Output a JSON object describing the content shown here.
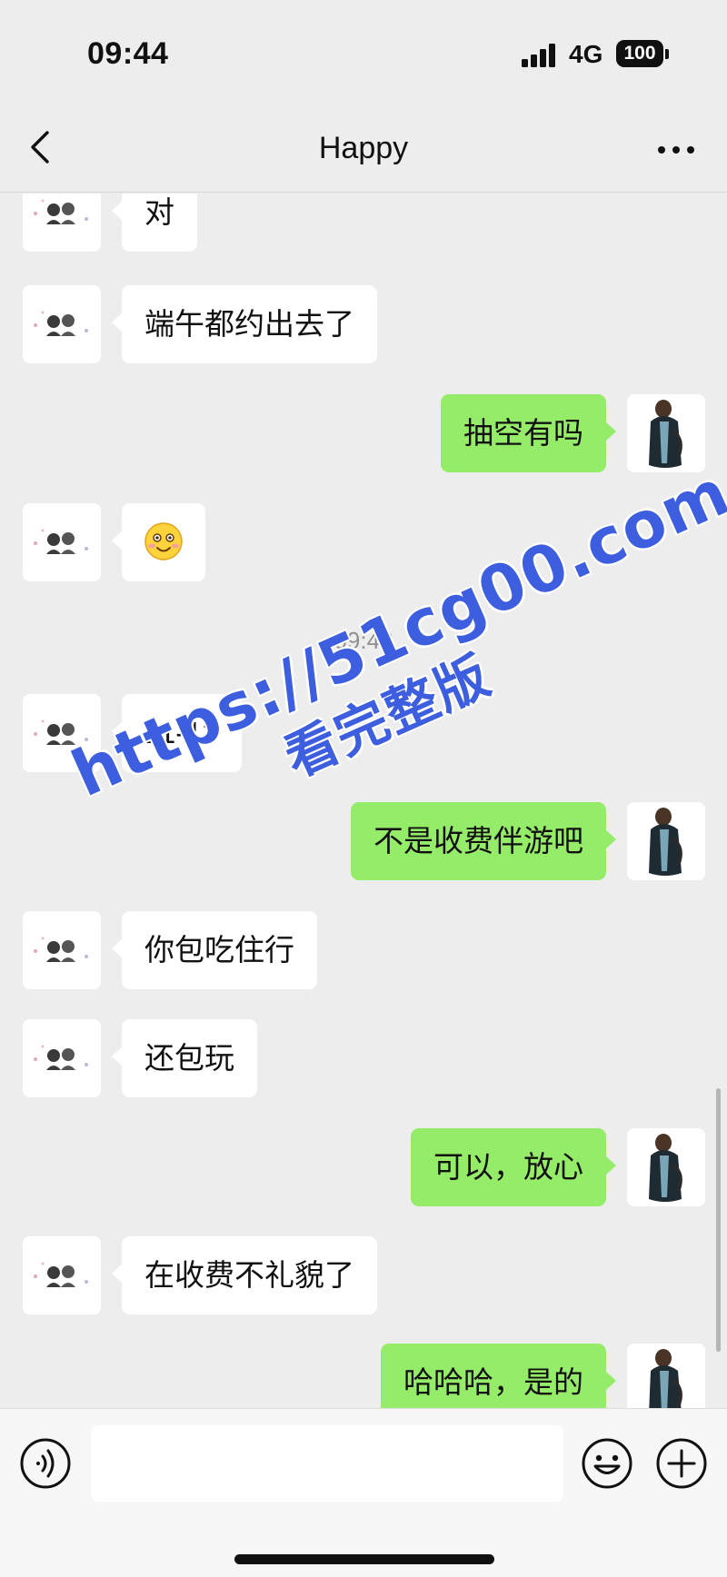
{
  "status_bar": {
    "time": "09:44",
    "network": "4G",
    "battery": "100"
  },
  "nav": {
    "title": "Happy"
  },
  "chat": {
    "time_divider": "09:42",
    "messages": [
      {
        "side": "in",
        "text": "对"
      },
      {
        "side": "in",
        "text": "端午都约出去了"
      },
      {
        "side": "out",
        "text": "抽空有吗"
      },
      {
        "side": "in",
        "text": "",
        "emoji": "grinning-face-emoji"
      },
      {
        "side": "in",
        "text": "11-13"
      },
      {
        "side": "out",
        "text": "不是收费伴游吧"
      },
      {
        "side": "in",
        "text": "你包吃住行"
      },
      {
        "side": "in",
        "text": "还包玩"
      },
      {
        "side": "out",
        "text": "可以，放心"
      },
      {
        "side": "in",
        "text": "在收费不礼貌了"
      },
      {
        "side": "out",
        "text": "哈哈哈，是的"
      }
    ]
  },
  "watermark": {
    "url": "https://51cg00.com",
    "subtitle": "看完整版"
  },
  "colors": {
    "background": "#ededed",
    "incoming_bubble": "#ffffff",
    "outgoing_bubble": "#95ec69",
    "watermark": "#3d5fdf"
  },
  "icons": {
    "back": "back-chevron-icon",
    "more": "more-dots-icon",
    "voice": "voice-input-icon",
    "emoji": "emoji-icon",
    "plus": "plus-icon"
  }
}
